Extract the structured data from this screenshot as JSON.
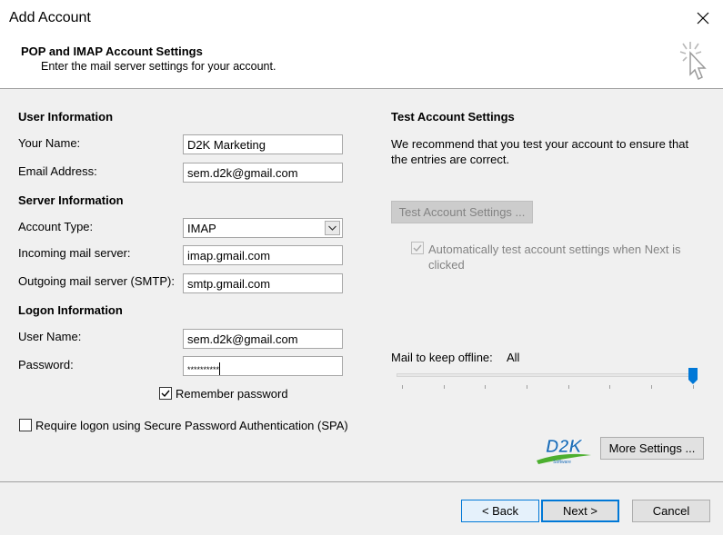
{
  "window": {
    "title": "Add Account"
  },
  "header": {
    "title": "POP and IMAP Account Settings",
    "subtitle": "Enter the mail server settings for your account."
  },
  "user_info": {
    "section_label": "User Information",
    "name_label": "Your Name:",
    "name_value": "D2K Marketing",
    "email_label": "Email Address:",
    "email_value": "sem.d2k@gmail.com"
  },
  "server_info": {
    "section_label": "Server Information",
    "account_type_label": "Account Type:",
    "account_type_value": "IMAP",
    "incoming_label": "Incoming mail server:",
    "incoming_value": "imap.gmail.com",
    "outgoing_label": "Outgoing mail server (SMTP):",
    "outgoing_value": "smtp.gmail.com"
  },
  "logon_info": {
    "section_label": "Logon Information",
    "username_label": "User Name:",
    "username_value": "sem.d2k@gmail.com",
    "password_label": "Password:",
    "password_value": "**********",
    "remember_label": "Remember password",
    "remember_checked": true,
    "spa_label": "Require logon using Secure Password Authentication (SPA)",
    "spa_checked": false
  },
  "test_settings": {
    "section_label": "Test Account Settings",
    "description": "We recommend that you test your account to ensure that the entries are correct.",
    "test_button": "Test Account Settings ...",
    "auto_test_label": "Automatically test account settings when Next is clicked",
    "auto_test_checked": true
  },
  "offline": {
    "label": "Mail to keep offline:",
    "value": "All",
    "slider_level": 1.0
  },
  "logo": {
    "text": "D2K",
    "tagline": "Software"
  },
  "buttons": {
    "more_settings": "More Settings ...",
    "back": "< Back",
    "next": "Next >",
    "cancel": "Cancel"
  },
  "colors": {
    "accent": "#0078d7",
    "logo_blue": "#1f6fb8",
    "logo_green": "#4caf2f"
  }
}
